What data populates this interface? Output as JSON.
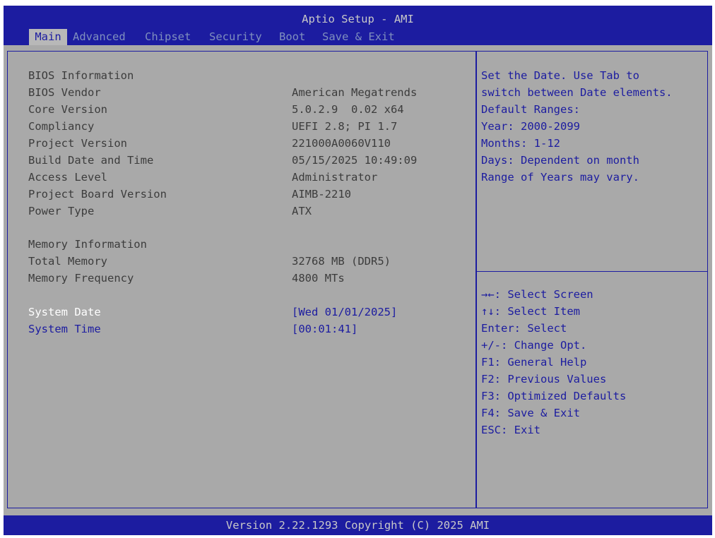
{
  "app_title": "Aptio Setup - AMI",
  "tabs": [
    {
      "label": "Main",
      "active": true
    },
    {
      "label": "Advanced",
      "active": false
    },
    {
      "label": "Chipset",
      "active": false
    },
    {
      "label": "Security",
      "active": false
    },
    {
      "label": "Boot",
      "active": false
    },
    {
      "label": "Save & Exit",
      "active": false
    }
  ],
  "bios_info": {
    "heading": "BIOS Information",
    "rows": [
      {
        "label": "BIOS Vendor",
        "value": "American Megatrends"
      },
      {
        "label": "Core Version",
        "value": "5.0.2.9  0.02 x64"
      },
      {
        "label": "Compliancy",
        "value": "UEFI 2.8; PI 1.7"
      },
      {
        "label": "Project Version",
        "value": "221000A0060V110"
      },
      {
        "label": "Build Date and Time",
        "value": "05/15/2025 10:49:09"
      },
      {
        "label": "Access Level",
        "value": "Administrator"
      },
      {
        "label": "Project Board Version",
        "value": "AIMB-2210"
      },
      {
        "label": "Power Type",
        "value": "ATX"
      }
    ]
  },
  "memory_info": {
    "heading": "Memory Information",
    "rows": [
      {
        "label": "Total Memory",
        "value": "32768 MB (DDR5)"
      },
      {
        "label": "Memory Frequency",
        "value": "4800 MTs"
      }
    ]
  },
  "system_date": {
    "label": "System Date",
    "value": "[Wed 01/01/2025]"
  },
  "system_time": {
    "label": "System Time",
    "value": "[00:01:41]"
  },
  "help_text": [
    "Set the Date. Use Tab to",
    "switch between Date elements.",
    "Default Ranges:",
    "Year: 2000-2099",
    "Months: 1-12",
    "Days: Dependent on month",
    "Range of Years may vary."
  ],
  "key_help": [
    "→←: Select Screen",
    "↑↓: Select Item",
    "Enter: Select",
    "+/-: Change Opt.",
    "F1: General Help",
    "F2: Previous Values",
    "F3: Optimized Defaults",
    "F4: Save & Exit",
    "ESC: Exit"
  ],
  "footer": "Version 2.22.1293 Copyright (C) 2025 AMI",
  "colors": {
    "header_blue": "#1c1ca0",
    "panel_gray": "#a9a9a9",
    "text_dark": "#3c3c3c",
    "highlight": "#ffffff"
  }
}
